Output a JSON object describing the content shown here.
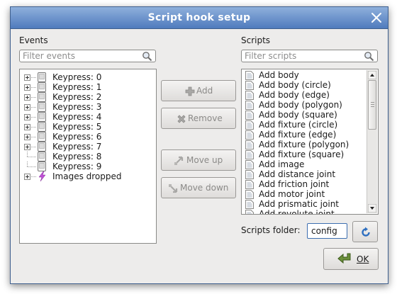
{
  "dialog": {
    "title": "Script hook setup"
  },
  "events": {
    "label": "Events",
    "filter_placeholder": "Filter events",
    "items": [
      {
        "label": "Keypress: 0",
        "icon": "key-icon",
        "expandable": true
      },
      {
        "label": "Keypress: 1",
        "icon": "key-icon",
        "expandable": true
      },
      {
        "label": "Keypress: 2",
        "icon": "key-icon",
        "expandable": true
      },
      {
        "label": "Keypress: 3",
        "icon": "key-icon",
        "expandable": true
      },
      {
        "label": "Keypress: 4",
        "icon": "key-icon",
        "expandable": true
      },
      {
        "label": "Keypress: 5",
        "icon": "key-icon",
        "expandable": true
      },
      {
        "label": "Keypress: 6",
        "icon": "key-icon",
        "expandable": true
      },
      {
        "label": "Keypress: 7",
        "icon": "key-icon",
        "expandable": true
      },
      {
        "label": "Keypress: 8",
        "icon": "key-icon",
        "expandable": false
      },
      {
        "label": "Keypress: 9",
        "icon": "key-icon",
        "expandable": false
      },
      {
        "label": "Images dropped",
        "icon": "lightning-icon",
        "expandable": true
      }
    ]
  },
  "scripts": {
    "label": "Scripts",
    "filter_placeholder": "Filter scripts",
    "items": [
      "Add body",
      "Add body (circle)",
      "Add body (edge)",
      "Add body (polygon)",
      "Add body (square)",
      "Add fixture (circle)",
      "Add fixture (edge)",
      "Add fixture (polygon)",
      "Add fixture (square)",
      "Add image",
      "Add distance joint",
      "Add friction joint",
      "Add motor joint",
      "Add prismatic joint",
      "Add revolute joint"
    ],
    "folder_label": "Scripts folder:",
    "folder_value": "config"
  },
  "buttons": {
    "add": "Add",
    "remove": "Remove",
    "move_up": "Move up",
    "move_down": "Move down",
    "ok": "OK"
  },
  "colors": {
    "titlebar_top": "#8fb0dc",
    "titlebar_bottom": "#4f7bbd",
    "dialog_bg": "#edeceb",
    "disabled_text": "#8b8a88",
    "focus_border": "#3d6eb0"
  }
}
